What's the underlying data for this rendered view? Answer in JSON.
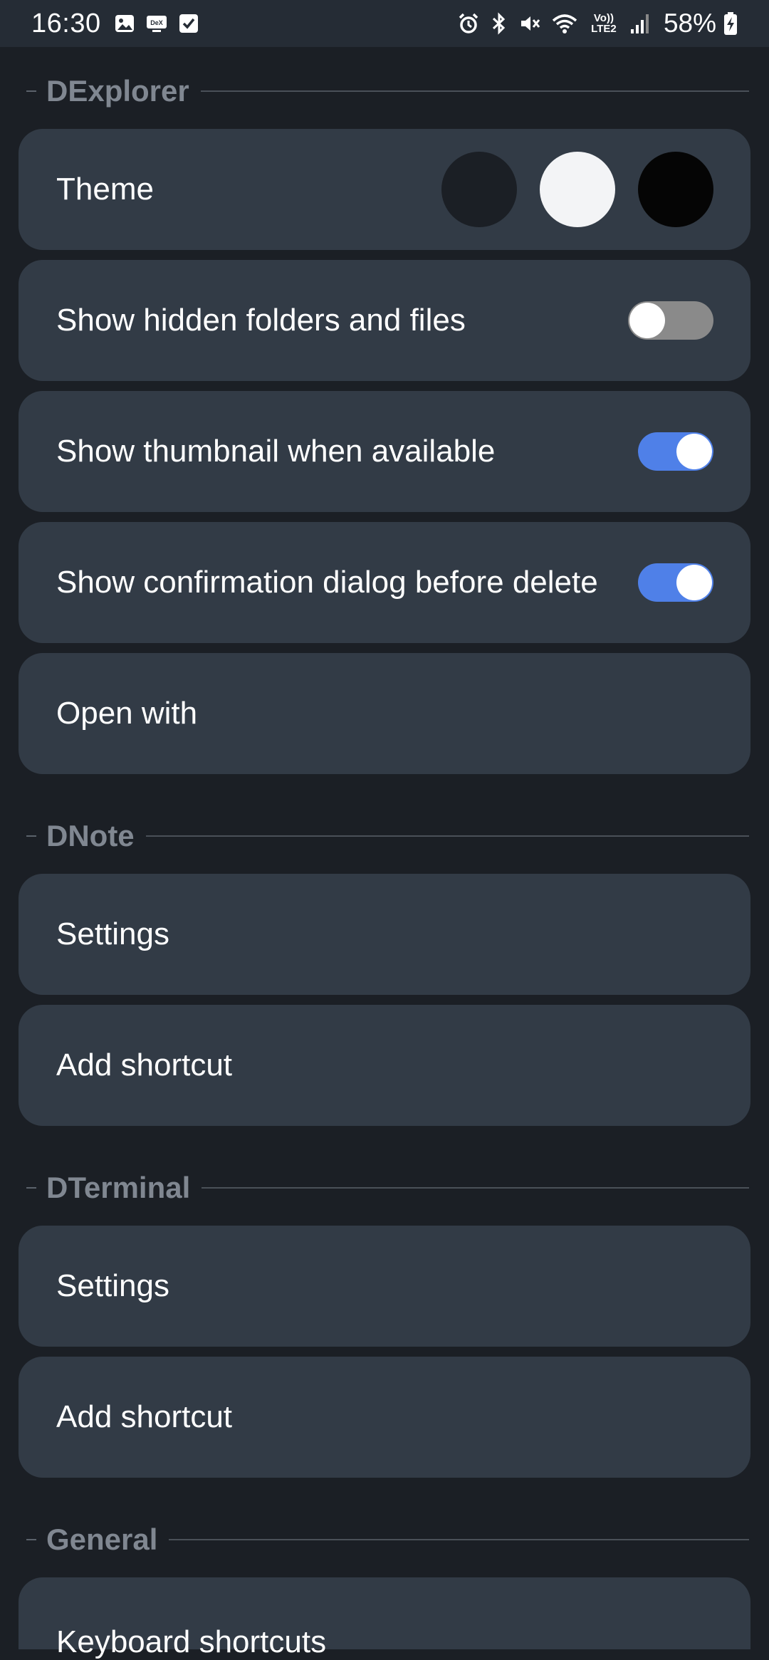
{
  "status_bar": {
    "time": "16:30",
    "battery": "58%",
    "network_label": "Vo)) LTE2",
    "icons_left": [
      "gallery-icon",
      "dex-icon",
      "checkbox-icon"
    ],
    "icons_right": [
      "alarm-icon",
      "bluetooth-icon",
      "mute-icon",
      "wifi-icon",
      "volte-icon",
      "signal-icon",
      "battery-charging-icon"
    ]
  },
  "sections": {
    "dexplorer": {
      "title": "DExplorer",
      "theme_label": "Theme",
      "theme_options": [
        "dark",
        "light",
        "black"
      ],
      "hidden_files_label": "Show hidden folders and files",
      "hidden_files_on": false,
      "thumbnail_label": "Show thumbnail when available",
      "thumbnail_on": true,
      "confirm_delete_label": "Show confirmation dialog before delete",
      "confirm_delete_on": true,
      "open_with_label": "Open with"
    },
    "dnote": {
      "title": "DNote",
      "settings_label": "Settings",
      "shortcut_label": "Add shortcut"
    },
    "dterminal": {
      "title": "DTerminal",
      "settings_label": "Settings",
      "shortcut_label": "Add shortcut"
    },
    "general": {
      "title": "General",
      "keyboard_label": "Keyboard shortcuts"
    }
  },
  "colors": {
    "background": "#1b1f25",
    "card": "#323b46",
    "accent": "#4f80e8",
    "header_text": "#808791"
  }
}
